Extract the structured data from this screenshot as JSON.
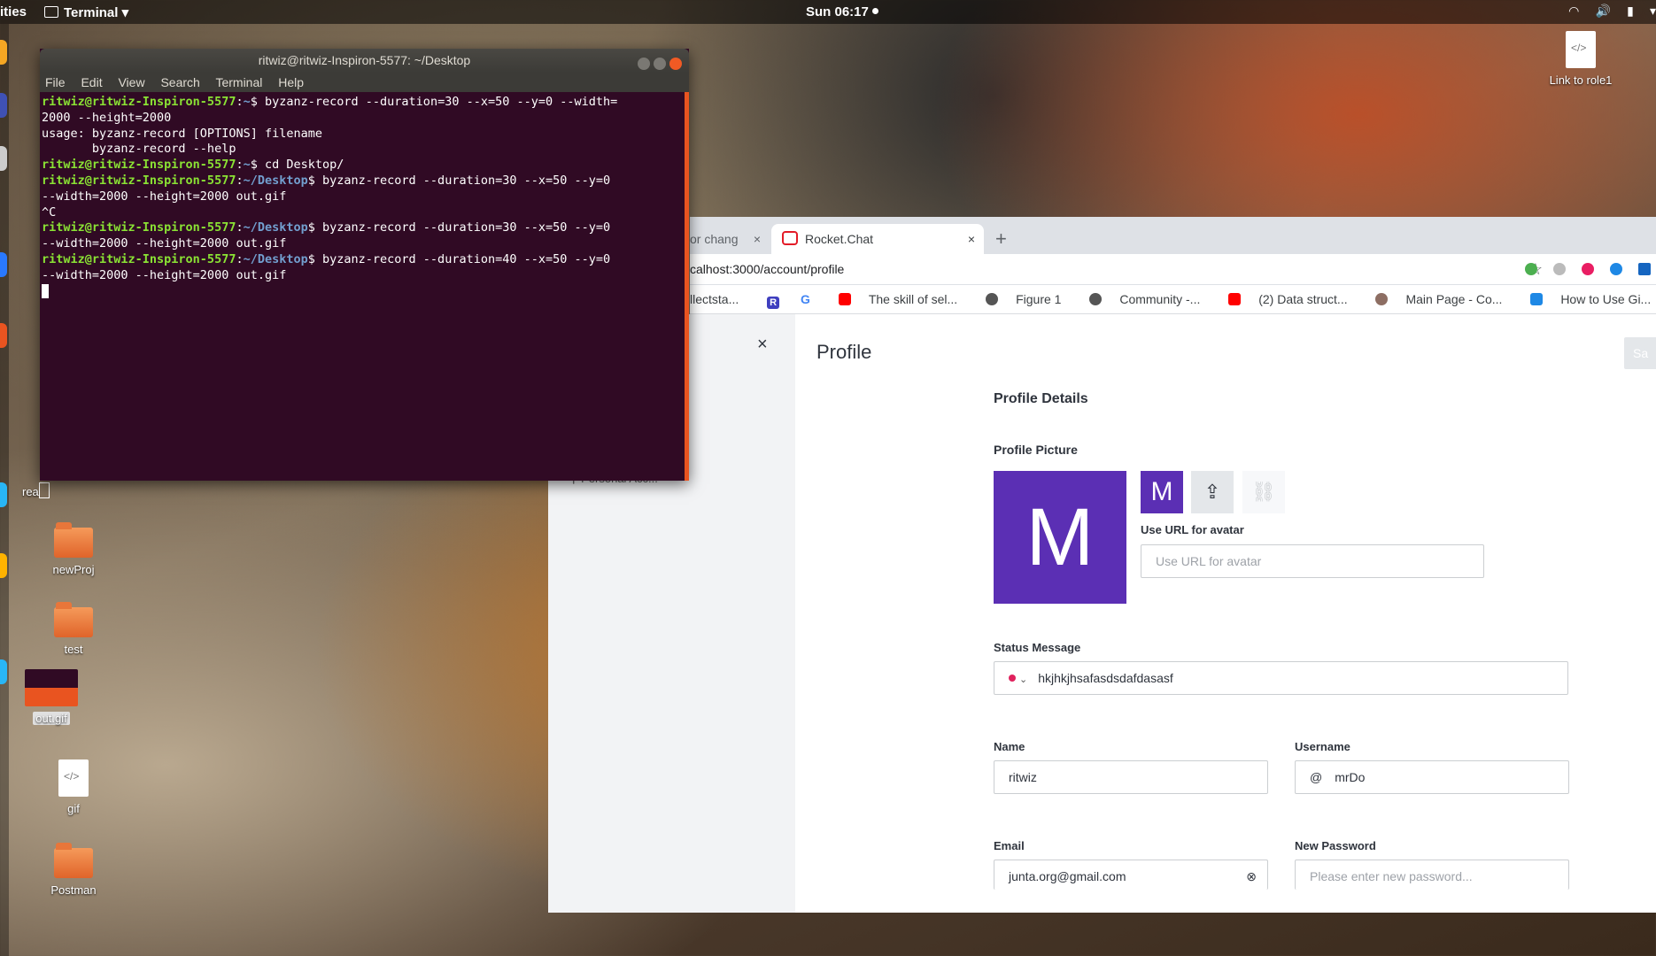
{
  "topbar": {
    "activities": "ities",
    "app_name": "Terminal",
    "app_menu_arrow": "▾",
    "clock": "Sun 06:17",
    "wifi_icon": "▾",
    "volume_icon": "🔊",
    "battery_icon": "▮",
    "power_icon": "▾"
  },
  "desktop": {
    "link_to_role1": "Link to role1",
    "rea_label": "rea",
    "newproj": "newProj",
    "test": "test",
    "out_gif": "out.gif",
    "gif": "gif",
    "postman": "Postman"
  },
  "terminal": {
    "title": "ritwiz@ritwiz-Inspiron-5577: ~/Desktop",
    "menu": [
      "File",
      "Edit",
      "View",
      "Search",
      "Terminal",
      "Help"
    ],
    "lines": [
      {
        "user": "ritwiz@ritwiz-Inspiron-5577",
        "path": "~",
        "cmd": " byzanz-record --duration=30 --x=50 --y=0 --width=\n2000 --height=2000"
      },
      {
        "out": "usage: byzanz-record [OPTIONS] filename\n       byzanz-record --help"
      },
      {
        "user": "ritwiz@ritwiz-Inspiron-5577",
        "path": "~",
        "cmd": " cd Desktop/"
      },
      {
        "user": "ritwiz@ritwiz-Inspiron-5577",
        "path": "~/Desktop",
        "cmd": " byzanz-record --duration=30 --x=50 --y=0\n--width=2000 --height=2000 out.gif"
      },
      {
        "out": "^C"
      },
      {
        "user": "ritwiz@ritwiz-Inspiron-5577",
        "path": "~/Desktop",
        "cmd": " byzanz-record --duration=30 --x=50 --y=0\n--width=2000 --height=2000 out.gif"
      },
      {
        "user": "ritwiz@ritwiz-Inspiron-5577",
        "path": "~/Desktop",
        "cmd": " byzanz-record --duration=40 --x=50 --y=0\n--width=2000 --height=2000 out.gif"
      }
    ]
  },
  "browser": {
    "tab1": "or chang",
    "tab2": "Rocket.Chat",
    "tab_close": "×",
    "new_tab": "+",
    "url": "calhost:3000/account/profile",
    "star": "☆",
    "bookmarks": [
      "llectsta...",
      "R",
      "G",
      "The skill of sel...",
      "Figure 1",
      "Community -...",
      "(2) Data struct...",
      "Main Page - Co...",
      "How to Use Gi..."
    ],
    "more": "»"
  },
  "sidebar": {
    "personal_access": "Personal Acc..."
  },
  "profile": {
    "close": "×",
    "title": "Profile",
    "save_label": "Sa",
    "section_title": "Profile Details",
    "picture_label": "Profile Picture",
    "avatar_letter": "M",
    "upload_icon": "⇪",
    "link_icon": "⛓",
    "url_label": "Use URL for avatar",
    "url_placeholder": "Use URL for avatar",
    "status_label": "Status Message",
    "status_value": "hkjhkjhsafasdsdafdasasf",
    "status_arrow": "⌄",
    "name_label": "Name",
    "name_value": "ritwiz",
    "username_label": "Username",
    "username_prefix": "@",
    "username_value": "mrDo",
    "email_label": "Email",
    "email_value": "junta.org@gmail.com",
    "email_icon": "⊗",
    "password_label": "New Password",
    "password_placeholder": "Please enter new password..."
  },
  "colors": {
    "avatar_bg": "#5b2fb4",
    "terminal_bg": "#300a24",
    "prompt_user": "#8ae234",
    "prompt_path": "#729fcf",
    "status_dot": "#e0225d"
  }
}
